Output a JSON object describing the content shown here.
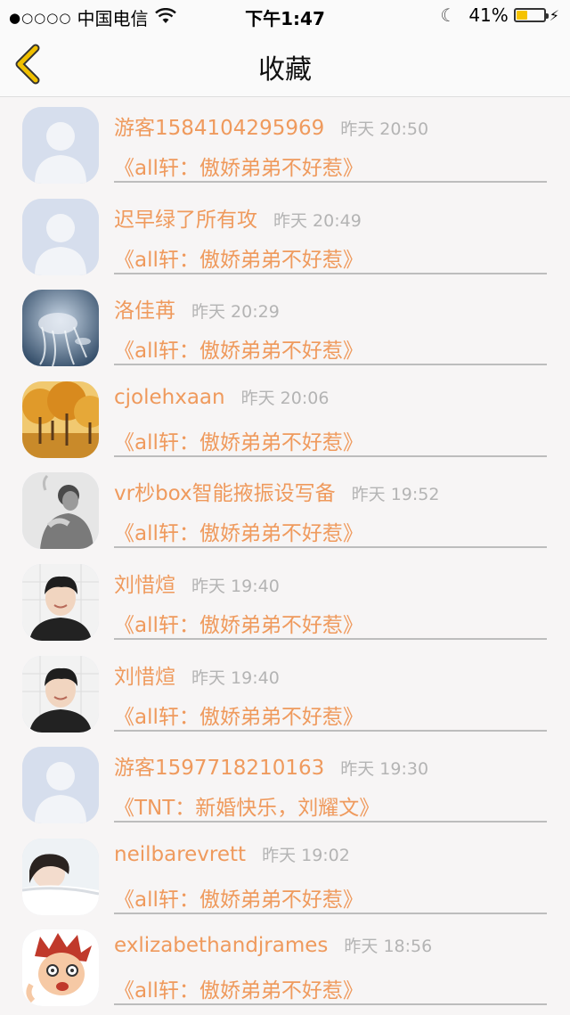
{
  "status_bar": {
    "signal_dots": "●○○○○",
    "carrier": "中国电信",
    "wifi_icon": "wifi-icon",
    "time": "下午1:47",
    "moon_icon": "moon-icon",
    "battery_percent": "41%",
    "battery_level": 0.41,
    "battery_color": "#f5c300"
  },
  "nav": {
    "back_icon": "chevron-left-icon",
    "title": "收藏"
  },
  "items": [
    {
      "name": "游客1584104295969",
      "time": "昨天 20:50",
      "title": "《all轩：傲娇弟弟不好惹》",
      "avatar": "default-avatar"
    },
    {
      "name": "迟早绿了所有攻",
      "time": "昨天 20:49",
      "title": "《all轩：傲娇弟弟不好惹》",
      "avatar": "default-avatar"
    },
    {
      "name": "洛佳苒",
      "time": "昨天 20:29",
      "title": "《all轩：傲娇弟弟不好惹》",
      "avatar": "jellyfish-photo"
    },
    {
      "name": "cjolehxaan",
      "time": "昨天 20:06",
      "title": "《all轩：傲娇弟弟不好惹》",
      "avatar": "autumn-trees-photo"
    },
    {
      "name": "vr杪box智能掖振设写备",
      "time": "昨天 19:52",
      "title": "《all轩：傲娇弟弟不好惹》",
      "avatar": "grayscale-person-photo"
    },
    {
      "name": "刘惜煊",
      "time": "昨天 19:40",
      "title": "《all轩：傲娇弟弟不好惹》",
      "avatar": "boy-portrait-photo"
    },
    {
      "name": "刘惜煊",
      "time": "昨天 19:40",
      "title": "《all轩：傲娇弟弟不好惹》",
      "avatar": "boy-portrait-photo"
    },
    {
      "name": "游客1597718210163",
      "time": "昨天 19:30",
      "title": "《TNT：新婚快乐，刘耀文》",
      "avatar": "default-avatar"
    },
    {
      "name": "neilbarevrett",
      "time": "昨天 19:02",
      "title": "《all轩：傲娇弟弟不好惹》",
      "avatar": "sleeping-girl-photo"
    },
    {
      "name": "exlizabethandjrames",
      "time": "昨天 18:56",
      "title": "《all轩：傲娇弟弟不好惹》",
      "avatar": "cartoon-character-photo"
    }
  ],
  "colors": {
    "accent": "#ef9a5d",
    "time_gray": "#b4b4b4",
    "back_chevron": "#f0c000",
    "background": "#f7f5f5"
  }
}
